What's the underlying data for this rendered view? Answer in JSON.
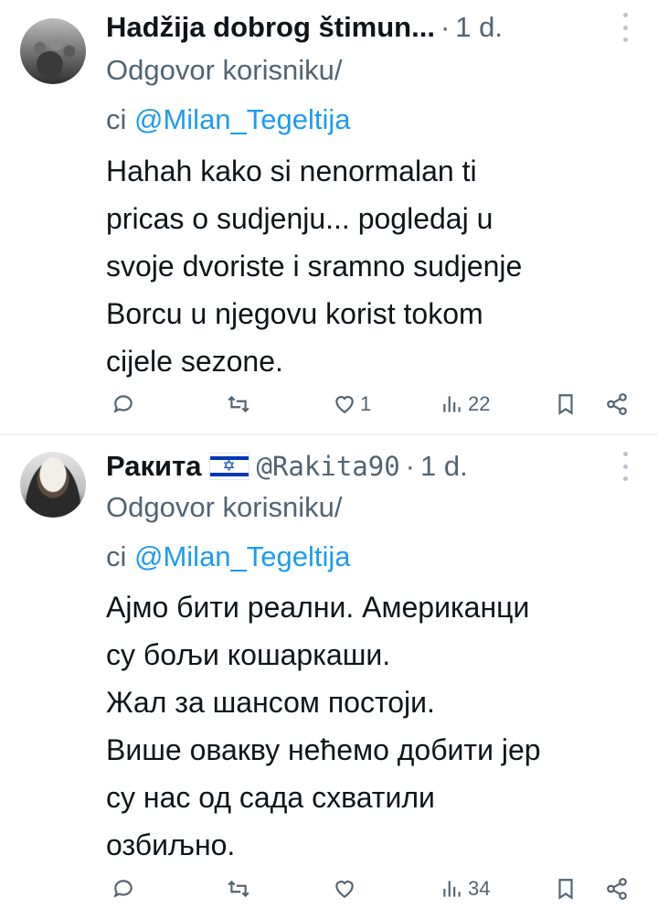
{
  "tweets": [
    {
      "name": "Hadžija dobrog štimun...",
      "handle": "",
      "time": "1 d.",
      "reply_prefix_line1": "Odgovor korisniku/",
      "reply_prefix_line2": "ci ",
      "reply_to": "@Milan_Tegeltija",
      "text_lines": [
        "Hahah kako si nenormalan ti",
        "pricas o sudjenju... pogledaj u",
        "svoje dvoriste i sramno sudjenje",
        "Borcu u njegovu korist tokom",
        "cijele sezone."
      ],
      "likes": "1",
      "views": "22",
      "avatar_icon": "avatar-group-photo"
    },
    {
      "name": "Ракита",
      "flag_icon": "israel-flag-icon",
      "handle": "@Rakita90",
      "time": "1 d.",
      "reply_prefix_line1": "Odgovor korisniku/",
      "reply_prefix_line2": "ci ",
      "reply_to": "@Milan_Tegeltija",
      "text_lines": [
        "Ајмо бити реални. Американци",
        "су бољи кошаркаши.",
        "Жал за шансом постоји.",
        "Више овакву нећемо добити јер",
        "су нас од сада схватили",
        "озбиљно."
      ],
      "likes": "",
      "views": "34",
      "avatar_icon": "avatar-portrait"
    }
  ],
  "separator": "·",
  "colors": {
    "text": "#0f1419",
    "secondary": "#536471",
    "accent": "#1d9bf0",
    "divider": "#eff3f4"
  }
}
